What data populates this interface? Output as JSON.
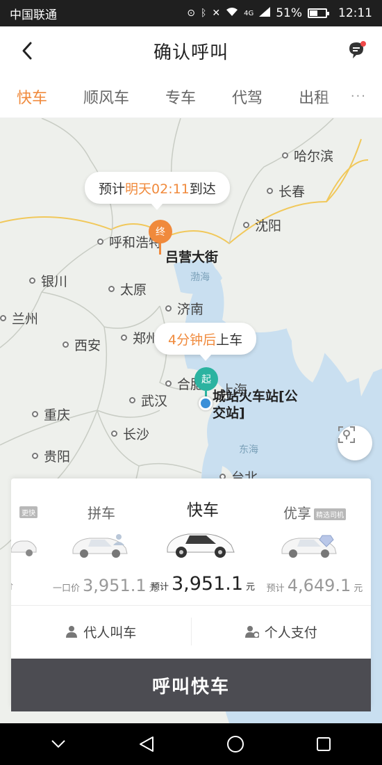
{
  "status_bar": {
    "carrier": "中国联通",
    "network": "4G",
    "battery": "51%",
    "battery_level": 0.51,
    "time": "12:11"
  },
  "header": {
    "title": "确认呼叫"
  },
  "tabs": [
    {
      "label": "快车",
      "active": true
    },
    {
      "label": "顺风车",
      "active": false
    },
    {
      "label": "专车",
      "active": false
    },
    {
      "label": "代驾",
      "active": false
    },
    {
      "label": "出租",
      "active": false
    }
  ],
  "tabs_more": "···",
  "map": {
    "cities": [
      "哈尔滨",
      "长春",
      "沈阳",
      "呼和浩特",
      "银川",
      "太原",
      "济南",
      "兰州",
      "西安",
      "郑州",
      "合肥",
      "上海",
      "武汉",
      "重庆",
      "长沙",
      "贵阳",
      "台北"
    ],
    "seas": [
      "渤海",
      "东海"
    ],
    "arrival_bubble": {
      "prefix": "预计",
      "highlight": "明天02:11",
      "suffix": "到达"
    },
    "pickup_bubble": {
      "highlight": "4分钟后",
      "suffix": "上车"
    },
    "end_pin": "终",
    "start_pin": "起",
    "destination": "吕营大街",
    "pickup_line1": "城站火车站[公",
    "pickup_line2": "交站]"
  },
  "car_options": [
    {
      "name": "",
      "tag": "更快",
      "price_prefix": "",
      "price": "",
      "unit": "价",
      "active": false
    },
    {
      "name": "拼车",
      "tag": "",
      "price_prefix": "一口价",
      "price": "3,951.1",
      "unit": "元",
      "active": false
    },
    {
      "name": "快车",
      "tag": "",
      "price_prefix": "预计",
      "price": "3,951.1",
      "unit": "元",
      "active": true
    },
    {
      "name": "优享",
      "tag": "精选司机",
      "price_prefix": "预计",
      "price": "4,649.1",
      "unit": "元",
      "active": false
    }
  ],
  "options": {
    "proxy_call": "代人叫车",
    "personal_pay": "个人支付"
  },
  "call_button": "呼叫快车",
  "colors": {
    "accent": "#f08a3c",
    "start_pin": "#2bb3a0",
    "end_pin": "#f08a3c",
    "button": "#4c4c52"
  }
}
